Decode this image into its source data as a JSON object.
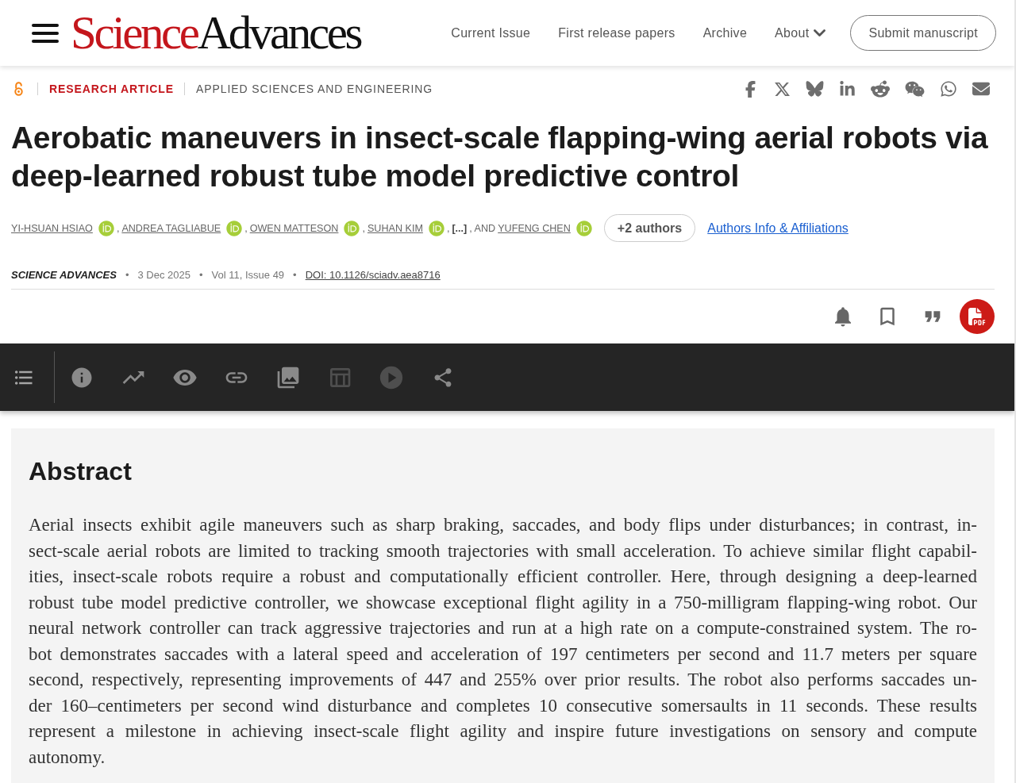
{
  "header": {
    "logo": {
      "first": "Science",
      "second": "Advances"
    },
    "nav": [
      {
        "label": "Current Issue",
        "kind": "link"
      },
      {
        "label": "First release papers",
        "kind": "link"
      },
      {
        "label": "Archive",
        "kind": "link"
      },
      {
        "label": "About",
        "kind": "dropdown"
      }
    ],
    "submit_button": "Submit manuscript"
  },
  "article": {
    "open_access": true,
    "article_type": "RESEARCH ARTICLE",
    "subject": "APPLIED SCIENCES AND ENGINEERING",
    "title": "Aerobatic maneuvers in insect-scale flapping-wing aerial robots via deep-learned robust tube model predictive control",
    "authors": [
      {
        "kind": "author",
        "name": "YI-HSUAN HSIAO",
        "orcid": true
      },
      {
        "kind": "text",
        "text": ","
      },
      {
        "kind": "author",
        "name": "ANDREA TAGLIABUE",
        "orcid": true
      },
      {
        "kind": "text",
        "text": ","
      },
      {
        "kind": "author",
        "name": "OWEN MATTESON",
        "orcid": true
      },
      {
        "kind": "text",
        "text": ","
      },
      {
        "kind": "author",
        "name": "SUHAN KIM",
        "orcid": true
      },
      {
        "kind": "text",
        "text": ","
      },
      {
        "kind": "ellipsis",
        "text": "[...]"
      },
      {
        "kind": "text",
        "text": ", AND"
      },
      {
        "kind": "author",
        "name": "YUFENG CHEN",
        "orcid": true
      }
    ],
    "more_authors_button": "+2 authors",
    "affiliations_link": "Authors Info & Affiliations",
    "meta": [
      {
        "kind": "journal",
        "text": "SCIENCE ADVANCES"
      },
      {
        "kind": "separator",
        "text": "•"
      },
      {
        "kind": "text",
        "text": "3 Dec 2025"
      },
      {
        "kind": "separator",
        "text": "•"
      },
      {
        "kind": "text",
        "text": "Vol 11, Issue 49"
      },
      {
        "kind": "separator",
        "text": "•"
      },
      {
        "kind": "link",
        "text": "DOI: 10.1126/sciadv.aea8716"
      }
    ]
  },
  "toolbar": {
    "items": [
      {
        "kind": "info",
        "disabled": false
      },
      {
        "kind": "metrics",
        "disabled": false
      },
      {
        "kind": "view",
        "disabled": false
      },
      {
        "kind": "references",
        "disabled": false
      },
      {
        "kind": "figures",
        "disabled": false
      },
      {
        "kind": "tables",
        "disabled": true
      },
      {
        "kind": "media",
        "disabled": true
      },
      {
        "kind": "share",
        "disabled": false
      }
    ]
  },
  "abstract": {
    "heading": "Abstract",
    "lines": [
      "Aerial insects exhibit agile maneuvers such as sharp braking, saccades, and body flips under disturbances; in contrast, in-",
      "sect-scale aerial robots are limited to tracking smooth trajectories with small acceleration. To achieve similar flight capabil-",
      "ities, insect-scale robots require a robust and computationally efficient controller. Here, through designing a deep-learned",
      "robust tube model predictive controller, we showcase exceptional flight agility in a 750-milligram flapping-wing robot. Our",
      "neural network controller can track aggressive trajectories and run at a high rate on a compute-constrained system. The ro-",
      "bot demonstrates saccades with a lateral speed and acceleration of 197 centimeters per second and 11.7 meters per square",
      "second, respectively, representing improvements of 447 and 255% over prior results. The robot also performs saccades un-",
      "der 160–centimeters per second wind disturbance and completes 10 consecutive somersaults in 11 seconds. These results",
      "represent a milestone in achieving insect-scale flight agility and inspire future investigations on sensory and compute",
      "autonomy."
    ]
  }
}
